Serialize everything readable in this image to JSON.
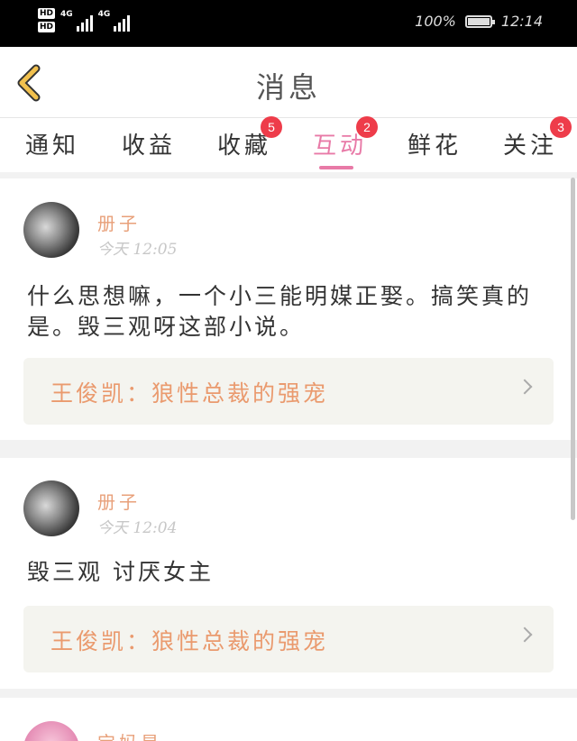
{
  "status_bar": {
    "hd1": "HD",
    "hd2": "HD",
    "signal1_label": "4G",
    "signal2_label": "4G",
    "battery_text": "100%",
    "battery_level": 1.0,
    "time": "12:14"
  },
  "header": {
    "title": "消息",
    "back_icon": "chevron-left-icon"
  },
  "tabs": [
    {
      "label": "通知",
      "badge": ""
    },
    {
      "label": "收益",
      "badge": ""
    },
    {
      "label": "收藏",
      "badge": "5"
    },
    {
      "label": "互动",
      "badge": "2",
      "active": true
    },
    {
      "label": "鲜花",
      "badge": ""
    },
    {
      "label": "关注",
      "badge": "3"
    }
  ],
  "messages": [
    {
      "username": "册子",
      "time": "今天 12:05",
      "text": "什么思想嘛，一个小三能明媒正娶。搞笑真的是。毁三观呀这部小说。",
      "book": "王俊凯：狼性总裁的强宠"
    },
    {
      "username": "册子",
      "time": "今天 12:04",
      "text": "毁三观 讨厌女主",
      "book": "王俊凯：狼性总裁的强宠"
    },
    {
      "username": "宝妈星",
      "time": "",
      "text": "",
      "book": ""
    }
  ],
  "colors": {
    "accent": "#e87aa7",
    "badge": "#ee3c4a",
    "username": "#e8a07a",
    "book_title": "#ea9a6e",
    "back_icon": "#f2c14e"
  }
}
